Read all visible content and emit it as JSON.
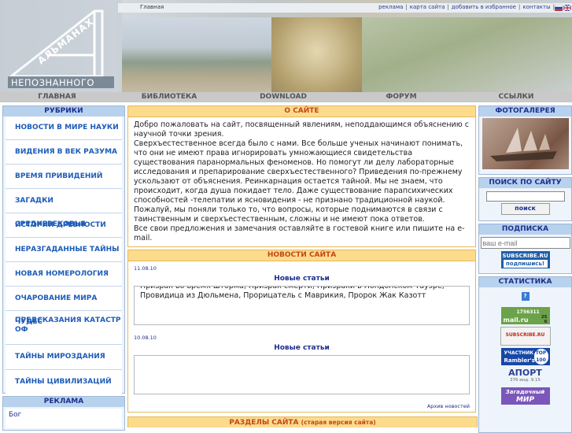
{
  "header": {
    "logo_line1": "АЛЬМАНАХ",
    "logo_line2": "НЕПОЗНАННОГО",
    "breadcrumb": "Главная",
    "top_links": [
      "реклама",
      "карта сайта",
      "добавить в избранное",
      "контакты"
    ]
  },
  "nav": [
    "ГЛАВНАЯ",
    "БИБЛИОТЕКА",
    "DOWNLOAD",
    "ФОРУМ",
    "ССЫЛКИ"
  ],
  "left": {
    "rubrics_title": "РУБРИКИ",
    "rubrics": [
      "НОВОСТИ В МИРЕ НАУКИ",
      "ВИДЕНИЯ В ВЕК РАЗУМА",
      "ВРЕМЯ ПРИВИДЕНИЙ",
      "ЗАГАДКИ СРЕДНЕВЕКОВЬЯ",
      "ИСТОРИИ ДРЕВНОСТИ",
      "НЕРАЗГАДАННЫЕ ТАЙНЫ",
      "НОВАЯ НОМЕРОЛОГИЯ",
      "ОЧАРОВАНИЕ МИРА ЧУДЕС",
      "ПРЕДСКАЗАНИЯ КАТАСТРОФ",
      "ТАЙНЫ МИРОЗДАНИЯ",
      "ТАЙНЫ ЦИВИЛИЗАЦИЙ"
    ],
    "ads_title": "РЕКЛАМА",
    "ads_text": "Бог"
  },
  "center": {
    "about_title": "О САЙТЕ",
    "about_text": [
      "Добро пожаловать на сайт, посвященный явлениям, неподдающимся объяснению с научной точки зрения.",
      "Сверхъестественное всегда было с нами. Все больше ученых начинают понимать, что они не имеют права игнорировать умножающиеся свидетельства существования паранормальных феноменов. Но помогут ли делу лабораторные исследования и препарирование сверхъестественного? Приведения по-прежнему ускользают от объяснения. Реинкарнация остается тайной. Мы не знаем, что происходит, когда душа покидает тело. Даже существование парапсихических способностей -телепатии и ясновидения - не признано традиционной наукой.",
      "Пожалуй, мы поняли только то, что вопросы, которые поднимаются в связи с таинственным и сверхъестественным, сложны и не имеют пока ответов.",
      "Все свои предложения и замечания оставляйте в гостевой книге или пишите на e-mail."
    ],
    "news_title": "НОВОСТИ САЙТА",
    "news": [
      {
        "date": "11.08.10",
        "title": "Новые статьи",
        "text": "Призрак во время шторма, Призрак смерти, Призраки в Лондонском Тауэре, Провидица из Дюльмена, Прорицатель с Маврикия, Пророк Жак Казотт"
      },
      {
        "date": "10.08.10",
        "title": "Новые статьи",
        "text": ""
      }
    ],
    "archive_link": "Архив новостей",
    "sections_title": "РАЗДЕЛЫ САЙТА",
    "sections_note": "(старая версия сайта)"
  },
  "right": {
    "gallery_title": "ФОТОГАЛЕРЕЯ",
    "search_title": "ПОИСК ПО САЙТУ",
    "search_button": "поиск",
    "subscribe_title": "ПОДПИСКА",
    "email_placeholder": "ваш e-mail",
    "subscribe_badge_line1": "SUBSCRIBE.RU",
    "subscribe_badge_line2": "подпишись!",
    "stats_title": "СТАТИСТИКА",
    "counters": {
      "liveinternet_value": "1756311",
      "liveinternet_small_top": "25",
      "liveinternet_small_bottom": "6",
      "mailru_label": "mail.ru",
      "subscribe_counter_label": "SUBSCRIBE.RU",
      "rambler_label": "УЧАСТНИК",
      "rambler_brand": "Rambler's",
      "rambler_top": "TOP",
      "rambler_num": "100",
      "aport_label": "АПОРТ",
      "aport_stats": "376 инд. 9.15",
      "zagadochny_line1": "Загадочный",
      "zagadochny_line2": "МИР"
    }
  }
}
